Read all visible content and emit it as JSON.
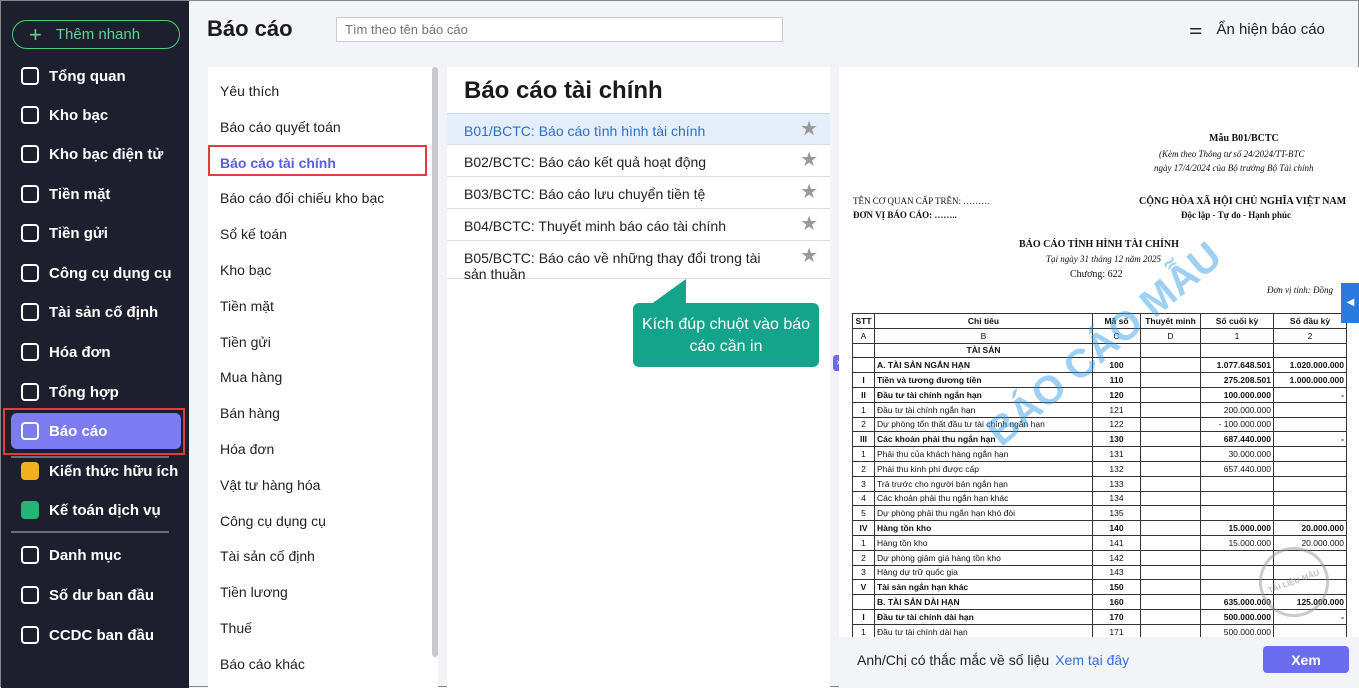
{
  "sidebar": {
    "quick_add": "Thêm nhanh",
    "items": [
      {
        "label": "Tổng quan",
        "icon": "pie-chart-icon"
      },
      {
        "label": "Kho bạc",
        "icon": "treasury-icon"
      },
      {
        "label": "Kho bạc điện tử",
        "icon": "e-treasury-icon"
      },
      {
        "label": "Tiền mặt",
        "icon": "cash-icon"
      },
      {
        "label": "Tiền gửi",
        "icon": "deposit-icon"
      },
      {
        "label": "Công cụ dụng cụ",
        "icon": "tools-icon"
      },
      {
        "label": "Tài sản cố định",
        "icon": "truck-icon"
      },
      {
        "label": "Hóa đơn",
        "icon": "invoice-icon"
      },
      {
        "label": "Tổng hợp",
        "icon": "summary-icon"
      },
      {
        "label": "Báo cáo",
        "icon": "report-chart-icon"
      },
      {
        "label": "Kiến thức hữu ích",
        "icon": "knowledge-icon"
      },
      {
        "label": "Kế toán dịch vụ",
        "icon": "service-icon"
      },
      {
        "label": "Danh mục",
        "icon": "list-icon"
      },
      {
        "label": "Số dư ban đầu",
        "icon": "balance-icon"
      },
      {
        "label": "CCDC ban đầu",
        "icon": "initial-tools-icon"
      }
    ]
  },
  "header": {
    "title": "Báo cáo",
    "search_placeholder": "Tìm theo tên báo cáo",
    "toggle_label": "Ẩn hiện báo cáo"
  },
  "categories": [
    "Yêu thích",
    "Báo cáo quyết toán",
    "Báo cáo tài chính",
    "Báo cáo đối chiếu kho bạc",
    "Sổ kế toán",
    "Kho bạc",
    "Tiền mặt",
    "Tiền gửi",
    "Mua hàng",
    "Bán hàng",
    "Hóa đơn",
    "Vật tư hàng hóa",
    "Công cụ dụng cụ",
    "Tài sản cố định",
    "Tiền lương",
    "Thuế",
    "Báo cáo khác"
  ],
  "reports": {
    "title": "Báo cáo tài chính",
    "items": [
      "B01/BCTC: Báo cáo tình hình tài chính",
      "B02/BCTC: Báo cáo kết quả hoạt động",
      "B03/BCTC: Báo cáo lưu chuyển tiền tệ",
      "B04/BCTC: Thuyết minh báo cáo tài chính",
      "B05/BCTC: Báo cáo về những thay đổi trong tài sản thuần"
    ]
  },
  "tooltip": "Kích đúp chuột vào báo cáo cần in",
  "preview": {
    "form": "Mẫu B01/BCTC",
    "ref1": "(Kèm theo Thông tư số 24/2024/TT-BTC",
    "ref2": "ngày 17/4/2024 của Bộ trưởng Bộ Tài chính",
    "agency": "TÊN CƠ QUAN CẤP TRÊN: ………",
    "unit": "ĐƠN VỊ BÁO CÁO: ……..",
    "nation": "CỘNG HÒA XÃ HỘI CHỦ NGHĨA VIỆT NAM",
    "motto": "Độc lập - Tự do - Hạnh phúc",
    "doc_title": "BÁO CÁO TÌNH HÌNH TÀI CHÍNH",
    "date": "Tại ngày 31 tháng 12 năm 2025",
    "chapter": "Chương: 622",
    "currency": "Đơn vị tính: Đồng",
    "watermark": "BÁO CÁO MẪU",
    "stamp": "TÀI LIỆU MẪU",
    "headers": [
      "STT",
      "Chỉ tiêu",
      "Mã số",
      "Thuyết minh",
      "Số cuối kỳ",
      "Số đầu kỳ"
    ],
    "rows": [
      [
        "A",
        "B",
        "C",
        "D",
        "1",
        "2",
        0
      ],
      [
        "",
        "TÀI SẢN",
        "",
        "",
        "",
        "",
        1
      ],
      [
        "",
        "A. TÀI SẢN NGẮN HẠN",
        "100",
        "",
        "1.077.648.501",
        "1.020.000.000",
        1
      ],
      [
        "I",
        "Tiền và tương đương tiền",
        "110",
        "",
        "275.208.501",
        "1.000.000.000",
        1
      ],
      [
        "II",
        "Đầu tư tài chính ngắn hạn",
        "120",
        "",
        "100.000.000",
        "-",
        1
      ],
      [
        "1",
        "Đầu tư tài chính ngắn hạn",
        "121",
        "",
        "200.000.000",
        "",
        0
      ],
      [
        "2",
        "Dự phòng tổn thất đầu tư tài chính ngắn hạn",
        "122",
        "",
        "- 100.000.000",
        "",
        0
      ],
      [
        "III",
        "Các khoản phải thu ngắn hạn",
        "130",
        "",
        "687.440.000",
        "-",
        1
      ],
      [
        "1",
        "Phải thu của khách hàng ngắn hạn",
        "131",
        "",
        "30.000.000",
        "",
        0
      ],
      [
        "2",
        "Phải thu kinh phí được cấp",
        "132",
        "",
        "657.440.000",
        "",
        0
      ],
      [
        "3",
        "Trả trước cho người bán ngắn hạn",
        "133",
        "",
        "",
        "",
        0
      ],
      [
        "4",
        "Các khoản phải thu ngắn hạn khác",
        "134",
        "",
        "",
        "",
        0
      ],
      [
        "5",
        "Dự phòng phải thu ngắn hạn khó đòi",
        "135",
        "",
        "",
        "",
        0
      ],
      [
        "IV",
        "Hàng tồn kho",
        "140",
        "",
        "15.000.000",
        "20.000.000",
        1
      ],
      [
        "1",
        "Hàng tồn kho",
        "141",
        "",
        "15.000.000",
        "20.000.000",
        0
      ],
      [
        "2",
        "Dự phòng giảm giá hàng tồn kho",
        "142",
        "",
        "",
        "",
        0
      ],
      [
        "3",
        "Hàng dự trữ quốc gia",
        "143",
        "",
        "",
        "",
        0
      ],
      [
        "V",
        "Tài sản ngắn hạn khác",
        "150",
        "",
        "",
        "",
        1
      ],
      [
        "",
        "B. TÀI SẢN DÀI HẠN",
        "160",
        "",
        "635.000.000",
        "125.000.000",
        1
      ],
      [
        "I",
        "Đầu tư tài chính dài hạn",
        "170",
        "",
        "500.000.000",
        "-",
        1
      ],
      [
        "1",
        "Đầu tư tài chính dài hạn",
        "171",
        "",
        "500.000.000",
        "",
        0
      ]
    ]
  },
  "footer": {
    "question": "Anh/Chị có thắc mắc về số liệu",
    "link": "Xem tại đây",
    "view_button": "Xem"
  }
}
